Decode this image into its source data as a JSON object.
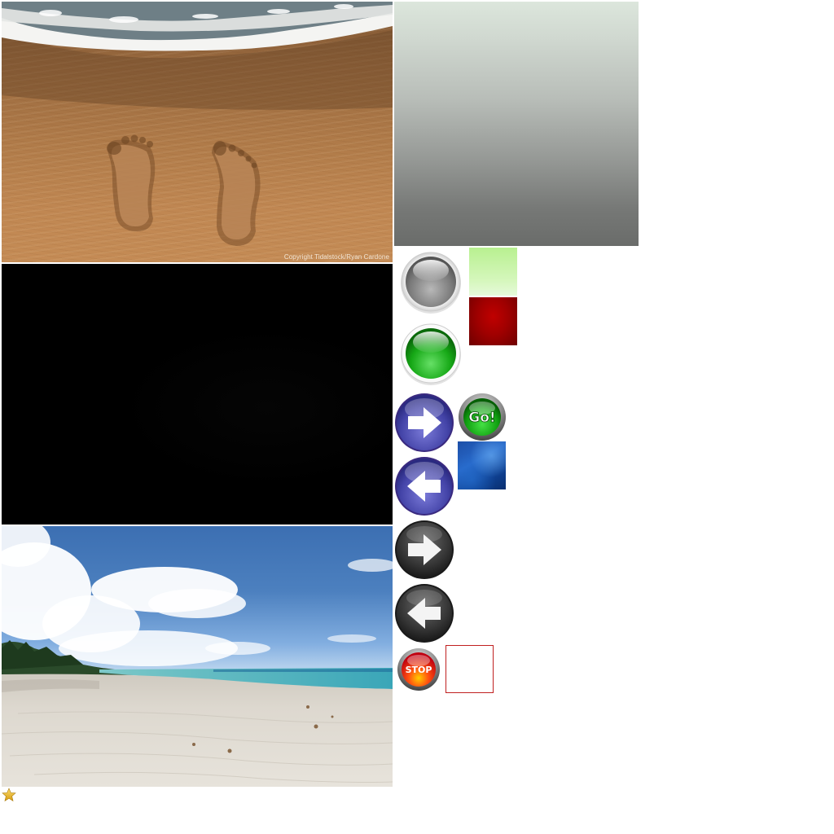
{
  "images": {
    "footprints": {
      "copyright": "Copyright Tidalstock/Ryan Cardone"
    }
  },
  "buttons": {
    "go": {
      "label": "Go!"
    },
    "stop": {
      "label": "STOP"
    }
  },
  "icons": {
    "gray_orb": "gray-orb-button-icon",
    "green_orb": "green-orb-button-icon",
    "arrow_right_purple": "arrow-right-icon",
    "arrow_left_purple": "arrow-left-icon",
    "arrow_right_dark": "arrow-right-icon",
    "arrow_left_dark": "arrow-left-icon",
    "star": "star-icon"
  },
  "colors": {
    "purple_button": "#4a4ab0",
    "dark_button": "#3a3a3a",
    "go_green": "#1aa81a",
    "stop_red": "#e01010",
    "swatch_green": "#c8f4a8",
    "swatch_red": "#a00000",
    "swatch_blue": "#1f5bb8",
    "box_border": "#c02020",
    "star": "#e8b820"
  }
}
